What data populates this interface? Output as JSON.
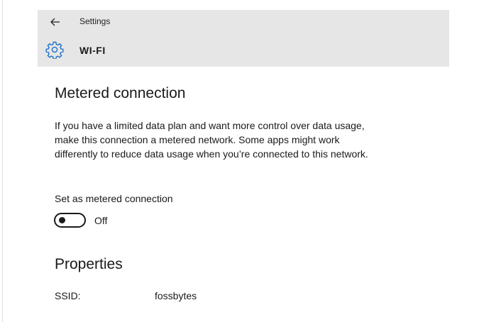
{
  "header": {
    "back_icon": "back-arrow-icon",
    "title": "Settings",
    "settings_icon": "gear-icon",
    "page_name": "WI-FI",
    "accent_color": "#1e6fc8"
  },
  "metered": {
    "heading": "Metered connection",
    "description": "If you have a limited data plan and want more control over data usage, make this connection a metered network. Some apps might work differently to reduce data usage when you’re connected to this network.",
    "toggle_label": "Set as metered connection",
    "toggle_state": "Off",
    "toggle_on": false
  },
  "properties": {
    "heading": "Properties",
    "rows": [
      {
        "key": "SSID:",
        "value": "fossbytes"
      }
    ]
  }
}
